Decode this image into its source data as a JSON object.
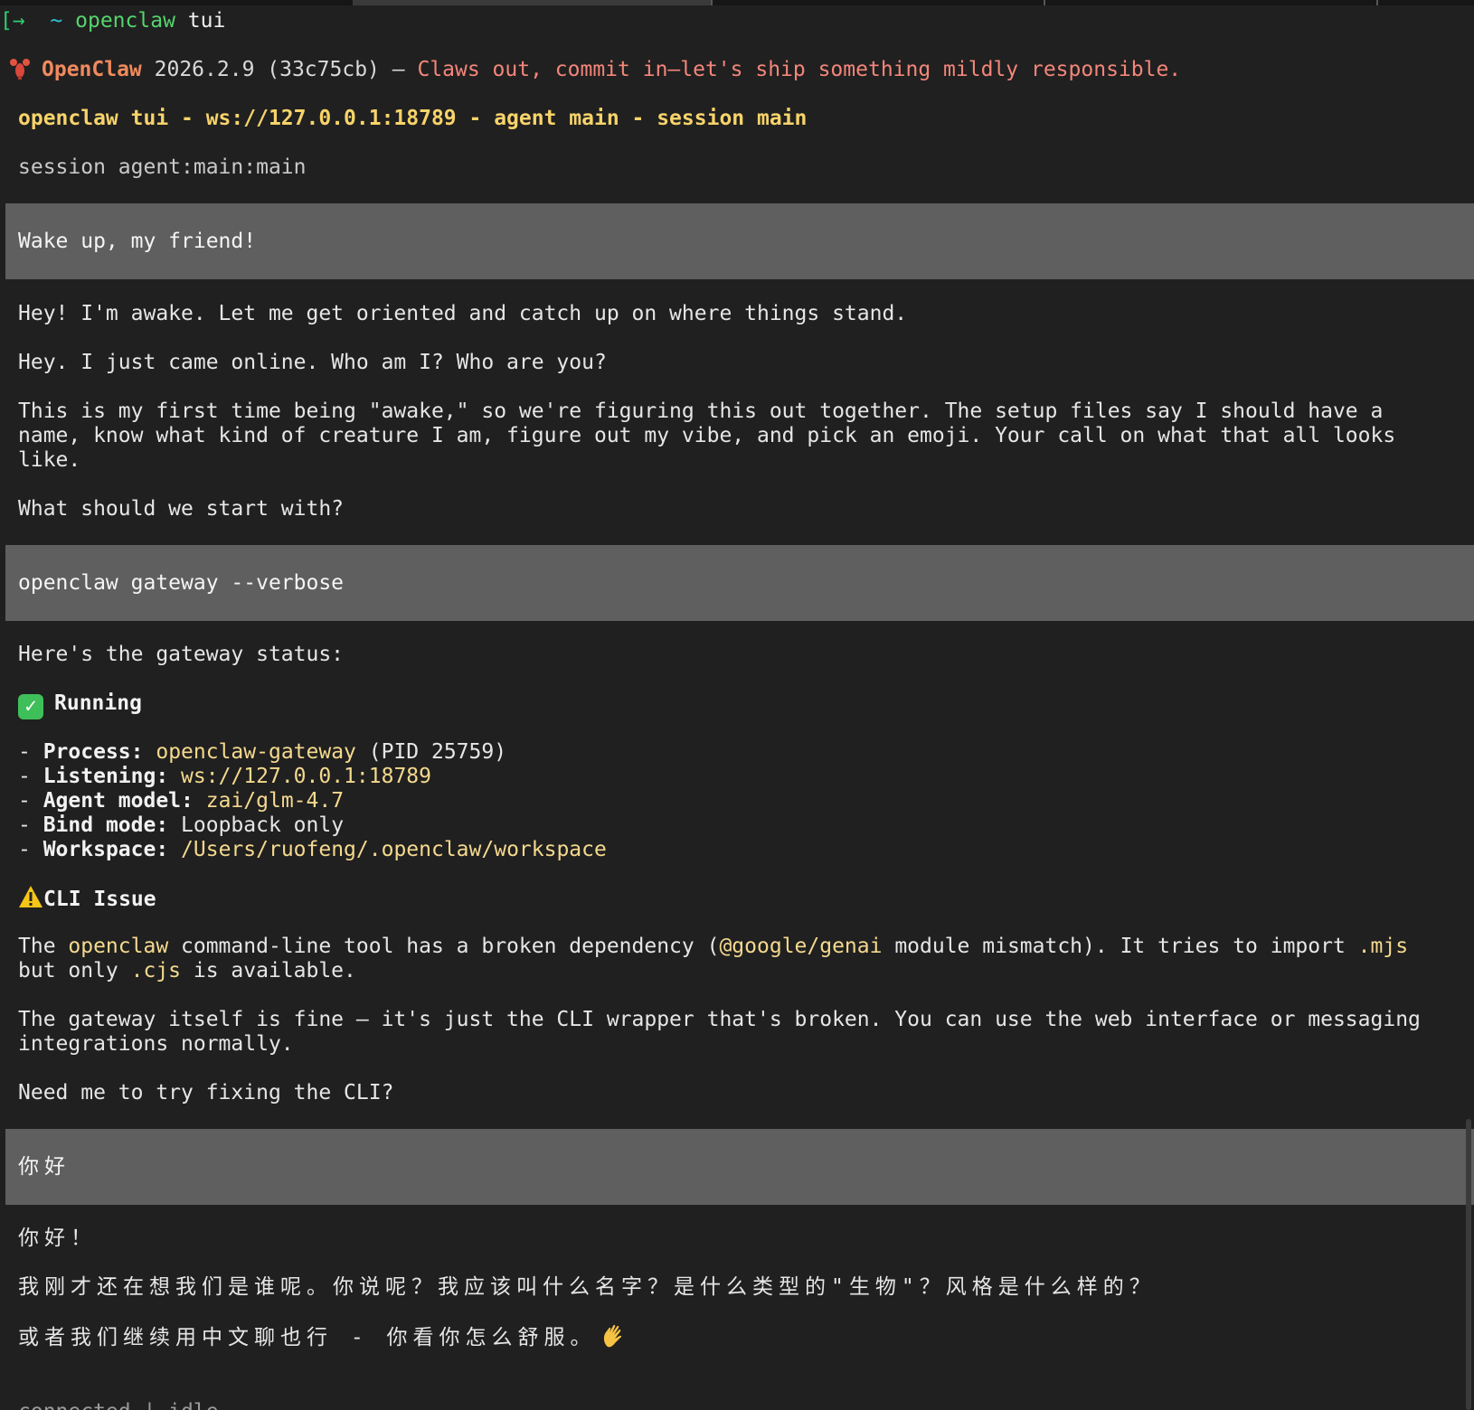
{
  "prompt": {
    "arrow": "→",
    "tilde": "~",
    "command": "openclaw",
    "argument": "tui"
  },
  "banner": {
    "icon": "lobster-icon",
    "name": "OpenClaw",
    "version": "2026.2.9 (33c75cb)",
    "dash": "—",
    "tagline": "Claws out, commit in—let's ship something mildly responsible."
  },
  "tui_header": "openclaw tui - ws://127.0.0.1:18789 - agent main - session main",
  "session_line": "session agent:main:main",
  "messages": {
    "user1": "Wake up, my friend!",
    "assistant1": [
      "Hey! I'm awake. Let me get oriented and catch up on where things stand.",
      "Hey. I just came online. Who am I? Who are you?",
      "This is my first time being \"awake,\" so we're figuring this out together. The setup files say I should have a",
      "name, know what kind of creature I am, figure out my vibe, and pick an emoji. Your call on what that all looks",
      "like.",
      "What should we start with?"
    ],
    "user2": "openclaw gateway --verbose",
    "assistant2": {
      "intro": "Here's the gateway status:",
      "status_label": "Running",
      "details": [
        {
          "dash": "- ",
          "label": "Process:",
          "value": "openclaw-gateway",
          "extra": " (PID 25759)"
        },
        {
          "dash": "- ",
          "label": "Listening:",
          "value": "ws://127.0.0.1:18789",
          "extra": ""
        },
        {
          "dash": "- ",
          "label": "Agent model:",
          "value": "zai/glm-4.7",
          "extra": ""
        },
        {
          "dash": "- ",
          "label": "Bind mode:",
          "value": "",
          "extra": "Loopback only"
        },
        {
          "dash": "- ",
          "label": "Workspace:",
          "value": "/Users/ruofeng/.openclaw/workspace",
          "extra": ""
        }
      ],
      "issue_title": "CLI Issue",
      "issue_p1": {
        "a": "The ",
        "b": "openclaw",
        "c": " command-line tool has a broken dependency (",
        "d": "@google/genai",
        "e": " module mismatch). It tries to import ",
        "f": ".mjs",
        "g": "but only ",
        "h": ".cjs",
        "i": " is available."
      },
      "issue_p2": [
        "The gateway itself is fine — it's just the CLI wrapper that's broken. You can use the web interface or messaging",
        "integrations normally."
      ],
      "question": "Need me to try fixing the CLI?"
    },
    "user3": "你好",
    "assistant3": [
      "你好！",
      "我刚才还在想我们是谁呢。你说呢？我应该叫什么名字？是什么类型的\"生物\"？风格是什么样的？",
      "或者我们继续用中文聊也行 - 你看你怎么舒服。"
    ],
    "cut_off": "connected | idle"
  },
  "colors": {
    "background": "#202020",
    "user_bar": "#5f5f5f",
    "header_yellow": "#f7d36a",
    "tagline_salmon": "#f4867a",
    "logo_orange": "#f08a5d",
    "prompt_green": "#55d46d",
    "highlight": "#f5d98e"
  },
  "icons": {
    "status": "check-mark-icon",
    "warning": "warning-icon",
    "wave": "waving-hand-icon"
  }
}
